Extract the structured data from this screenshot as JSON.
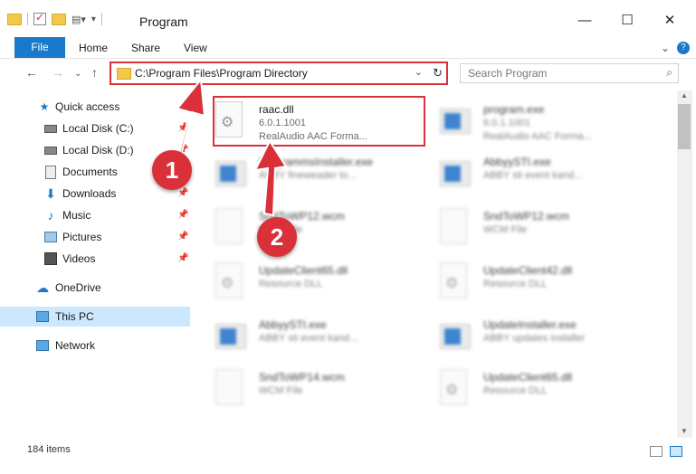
{
  "window": {
    "title": "Program"
  },
  "ribbon": {
    "tabs": [
      "File",
      "Home",
      "Share",
      "View"
    ]
  },
  "nav": {
    "address": "C:\\Program Files\\Program Directory",
    "search_placeholder": "Search Program"
  },
  "sidebar": {
    "items": [
      {
        "label": "Quick access",
        "icon": "star-icon",
        "pinned": false
      },
      {
        "label": "Local Disk (C:)",
        "icon": "drive-icon",
        "pinned": true
      },
      {
        "label": "Local Disk (D:)",
        "icon": "drive-icon",
        "pinned": true
      },
      {
        "label": "Documents",
        "icon": "documents-icon",
        "pinned": true
      },
      {
        "label": "Downloads",
        "icon": "download-icon",
        "pinned": true
      },
      {
        "label": "Music",
        "icon": "music-icon",
        "pinned": true
      },
      {
        "label": "Pictures",
        "icon": "pictures-icon",
        "pinned": true
      },
      {
        "label": "Videos",
        "icon": "videos-icon",
        "pinned": true
      },
      {
        "label": "OneDrive",
        "icon": "cloud-icon",
        "pinned": false
      },
      {
        "label": "This PC",
        "icon": "computer-icon",
        "pinned": false,
        "selected": true
      },
      {
        "label": "Network",
        "icon": "network-icon",
        "pinned": false
      }
    ]
  },
  "files": [
    {
      "name": "raac.dll",
      "line2": "6.0.1.1001",
      "line3": "RealAudio AAC Forma...",
      "type": "dll",
      "highlighted": true
    },
    {
      "name": "program.exe",
      "line2": "6.0.1.1001",
      "line3": "RealAudio AAC Forma...",
      "type": "exe"
    },
    {
      "name": "ProgrammsInstaller.exe",
      "line2": "ABBY fineweader to...",
      "line3": "",
      "type": "exe"
    },
    {
      "name": "AbbyySTI.exe",
      "line2": "ABBY sti event kand...",
      "line3": "",
      "type": "exe"
    },
    {
      "name": "SndToWP12.wcm",
      "line2": "WCM File",
      "line3": "",
      "type": "doc"
    },
    {
      "name": "SndToWP12.wcm",
      "line2": "WCM File",
      "line3": "",
      "type": "doc"
    },
    {
      "name": "UpdateClient65.dll",
      "line2": "Resource DLL",
      "line3": "",
      "type": "dll"
    },
    {
      "name": "UpdateClient42.dll",
      "line2": "Resource DLL",
      "line3": "",
      "type": "dll"
    },
    {
      "name": "AbbyySTI.exe",
      "line2": "ABBY sti event kand...",
      "line3": "",
      "type": "exe"
    },
    {
      "name": "UpdateInstaller.exe",
      "line2": "ABBY updates installer",
      "line3": "",
      "type": "exe"
    },
    {
      "name": "SndToWP14.wcm",
      "line2": "WCM File",
      "line3": "",
      "type": "doc"
    },
    {
      "name": "UpdateClient65.dll",
      "line2": "Resource DLL",
      "line3": "",
      "type": "dll"
    }
  ],
  "callouts": [
    "1",
    "2"
  ],
  "status": {
    "count": "184 items"
  },
  "colors": {
    "accent": "#1979ca",
    "highlight": "#d9303a",
    "selected": "#cce8ff"
  }
}
